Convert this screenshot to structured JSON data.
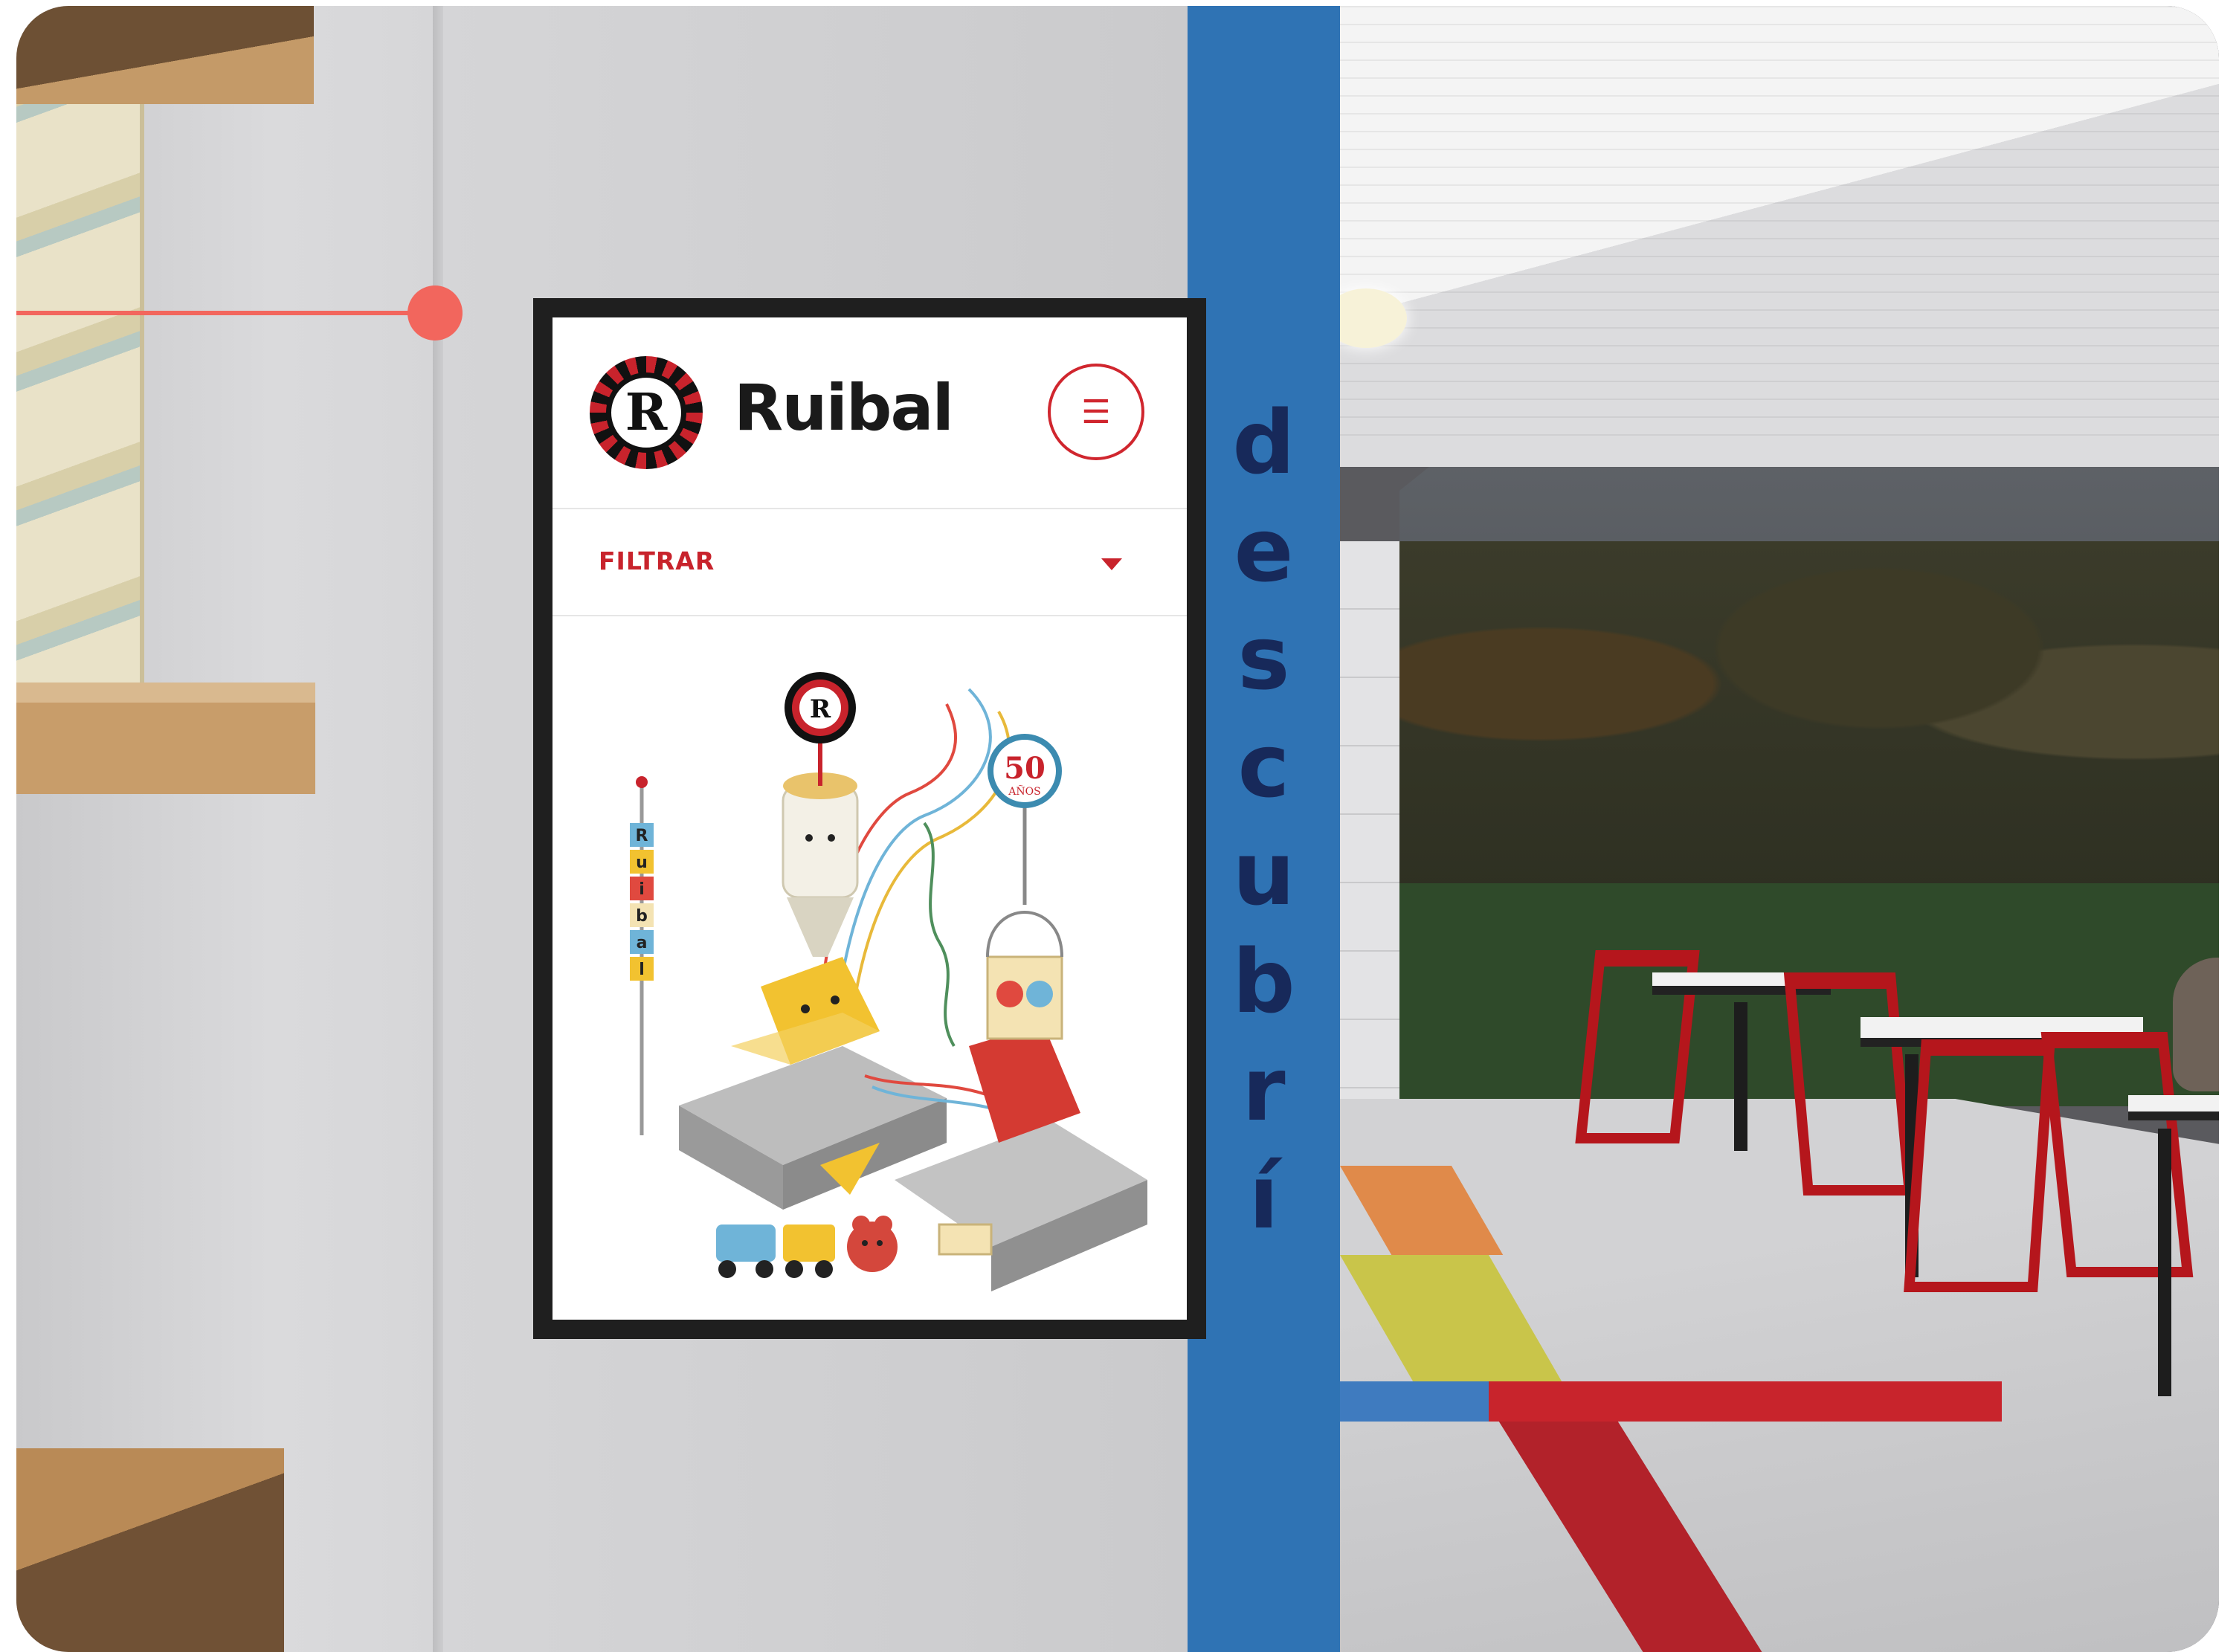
{
  "monitor": {
    "brand_name": "Ruibal",
    "logo_letter": "R",
    "menu_icon": "☰",
    "filter": {
      "label": "FILTRAR",
      "caret_icon": "caret-down-icon"
    },
    "illustration": {
      "badge_number": "50",
      "badge_subtitle": "AÑOS",
      "column_letters": [
        "R",
        "u",
        "i",
        "b",
        "a",
        "l"
      ]
    }
  },
  "band": {
    "letters": [
      "d",
      "e",
      "s",
      "c",
      "u",
      "b",
      "r",
      "í"
    ]
  },
  "colors": {
    "accent_red": "#c8232c",
    "band_blue": "#2f73b4",
    "band_text": "#17295a",
    "connector": "#f2665d"
  }
}
